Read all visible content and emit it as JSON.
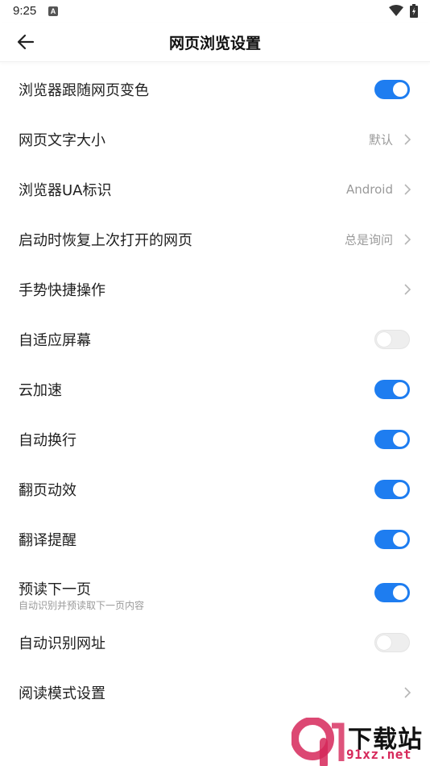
{
  "status_bar": {
    "time": "9:25",
    "notification_letter": "A"
  },
  "header": {
    "title": "网页浏览设置"
  },
  "settings": [
    {
      "label": "浏览器跟随网页变色",
      "control": "toggle",
      "on": true
    },
    {
      "label": "网页文字大小",
      "control": "link",
      "value": "默认"
    },
    {
      "label": "浏览器UA标识",
      "control": "link",
      "value": "Android"
    },
    {
      "label": "启动时恢复上次打开的网页",
      "control": "link",
      "value": "总是询问"
    },
    {
      "label": "手势快捷操作",
      "control": "link",
      "value": ""
    },
    {
      "label": "自适应屏幕",
      "control": "toggle",
      "on": false
    },
    {
      "label": "云加速",
      "control": "toggle",
      "on": true
    },
    {
      "label": "自动换行",
      "control": "toggle",
      "on": true
    },
    {
      "label": "翻页动效",
      "control": "toggle",
      "on": true
    },
    {
      "label": "翻译提醒",
      "control": "toggle",
      "on": true
    },
    {
      "label": "预读下一页",
      "sublabel": "自动识别并预读取下一页内容",
      "control": "toggle",
      "on": true
    },
    {
      "label": "自动识别网址",
      "control": "toggle",
      "on": false
    },
    {
      "label": "阅读模式设置",
      "control": "link",
      "value": ""
    }
  ],
  "watermark": {
    "text": "下载站",
    "url": "91xz.net",
    "logo_text": "9"
  },
  "colors": {
    "accent": "#1e7df0",
    "toggle_off": "#eeeeee",
    "secondary_text": "#9a9a9a",
    "watermark_red": "#d6285a"
  }
}
